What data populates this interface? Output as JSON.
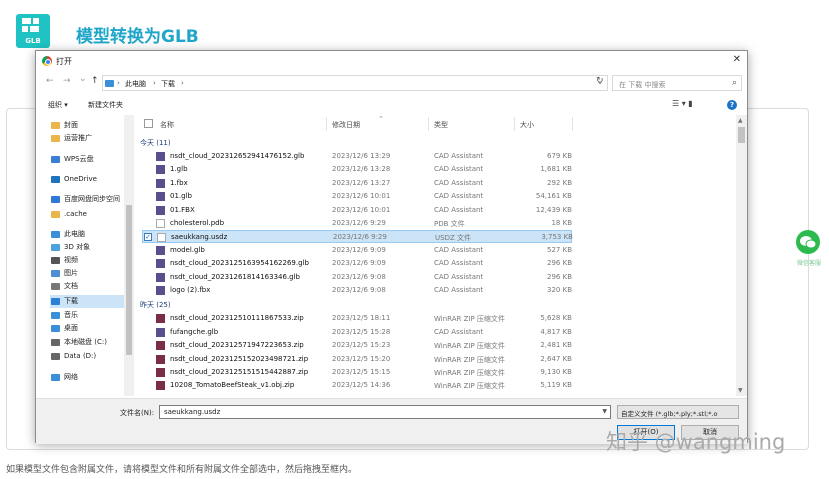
{
  "page": {
    "logo_text": "GLB",
    "title": "模型转换为GLB",
    "note": "如果模型文件包含附属文件，请将模型文件和所有附属文件全部选中，然后拖拽至框内。",
    "wechat_label": "微信客服",
    "watermark": "知乎 @wangming"
  },
  "dialog": {
    "title": "打开",
    "close": "✕",
    "nav": {
      "back": "←",
      "forward": "→",
      "recent": "⌄",
      "up": "↑"
    },
    "breadcrumb": [
      "此电脑",
      "下载"
    ],
    "breadcrumb_sep": "›",
    "refresh": "↻",
    "search_placeholder": "在 下载 中搜索",
    "toolbar": {
      "organize": "组织 ▾",
      "new_folder": "新建文件夹",
      "view": "☰ ▾  ▮",
      "help": "?"
    },
    "sidebar": [
      {
        "label": "封面",
        "icon": "folder-icon",
        "color": "#e8b64a"
      },
      {
        "label": "运营推广",
        "icon": "folder-icon",
        "color": "#e8b64a"
      },
      {
        "label": "WPS云盘",
        "icon": "cloud-icon",
        "color": "#3a7fd5"
      },
      {
        "label": "OneDrive",
        "icon": "cloud-icon",
        "color": "#1e73be"
      },
      {
        "label": "百度网盘同步空间",
        "icon": "baidu-icon",
        "color": "#2f7ad8"
      },
      {
        "label": ".cache",
        "icon": "folder-icon",
        "color": "#e8b64a"
      },
      {
        "label": "此电脑",
        "icon": "computer-icon",
        "color": "#3a8fd8"
      },
      {
        "label": "3D 对象",
        "icon": "cube-icon",
        "color": "#4aa3df"
      },
      {
        "label": "视频",
        "icon": "video-icon",
        "color": "#555"
      },
      {
        "label": "图片",
        "icon": "picture-icon",
        "color": "#4c8fd3"
      },
      {
        "label": "文档",
        "icon": "document-icon",
        "color": "#777"
      },
      {
        "label": "下载",
        "icon": "download-icon",
        "color": "#2b7fd4",
        "selected": true
      },
      {
        "label": "音乐",
        "icon": "music-icon",
        "color": "#3a8fd8"
      },
      {
        "label": "桌面",
        "icon": "desktop-icon",
        "color": "#3a8fd8"
      },
      {
        "label": "本地磁盘 (C:)",
        "icon": "drive-icon",
        "color": "#666"
      },
      {
        "label": "Data (D:)",
        "icon": "drive-icon",
        "color": "#666"
      },
      {
        "label": "网络",
        "icon": "network-icon",
        "color": "#3a8fd8"
      }
    ],
    "columns": {
      "name": "名称",
      "date": "修改日期",
      "type": "类型",
      "size": "大小"
    },
    "groups": [
      {
        "label": "今天 (11)",
        "files": [
          {
            "name": "nsdt_cloud_202312652941476152.glb",
            "date": "2023/12/6 13:29",
            "type": "CAD Assistant",
            "size": "679 KB",
            "icon": "cad-file-icon"
          },
          {
            "name": "1.glb",
            "date": "2023/12/6 13:28",
            "type": "CAD Assistant",
            "size": "1,681 KB",
            "icon": "cad-file-icon"
          },
          {
            "name": "1.fbx",
            "date": "2023/12/6 13:27",
            "type": "CAD Assistant",
            "size": "292 KB",
            "icon": "cad-file-icon"
          },
          {
            "name": "01.glb",
            "date": "2023/12/6 10:01",
            "type": "CAD Assistant",
            "size": "54,161 KB",
            "icon": "cad-file-icon"
          },
          {
            "name": "01.FBX",
            "date": "2023/12/6 10:01",
            "type": "CAD Assistant",
            "size": "12,439 KB",
            "icon": "cad-file-icon"
          },
          {
            "name": "cholesterol.pdb",
            "date": "2023/12/6 9:29",
            "type": "PDB 文件",
            "size": "18 KB",
            "icon": "blank-file-icon"
          },
          {
            "name": "saeukkang.usdz",
            "date": "2023/12/6 9:29",
            "type": "USDZ 文件",
            "size": "3,753 KB",
            "icon": "blank-file-icon",
            "selected": true
          },
          {
            "name": "model.glb",
            "date": "2023/12/6 9:09",
            "type": "CAD Assistant",
            "size": "527 KB",
            "icon": "cad-file-icon"
          },
          {
            "name": "nsdt_cloud_20231251639541​62269.glb",
            "date": "2023/12/6 9:09",
            "type": "CAD Assistant",
            "size": "296 KB",
            "icon": "cad-file-icon"
          },
          {
            "name": "nsdt_cloud_202312618141633​46.glb",
            "date": "2023/12/6 9:08",
            "type": "CAD Assistant",
            "size": "296 KB",
            "icon": "cad-file-icon"
          },
          {
            "name": "logo (2).fbx",
            "date": "2023/12/6 9:08",
            "type": "CAD Assistant",
            "size": "320 KB",
            "icon": "cad-file-icon"
          }
        ]
      },
      {
        "label": "昨天 (25)",
        "files": [
          {
            "name": "nsdt_cloud_2023125101118​67533.zip",
            "date": "2023/12/5 18:11",
            "type": "WinRAR ZIP 压缩文件",
            "size": "5,628 KB",
            "icon": "zip-file-icon"
          },
          {
            "name": "fufangche.glb",
            "date": "2023/12/5 15:28",
            "type": "CAD Assistant",
            "size": "4,817 KB",
            "icon": "cad-file-icon"
          },
          {
            "name": "nsdt_cloud_2023125719472​23653.zip",
            "date": "2023/12/5 15:23",
            "type": "WinRAR ZIP 压缩文件",
            "size": "2,481 KB",
            "icon": "zip-file-icon"
          },
          {
            "name": "nsdt_cloud_2023125152023​498721.zip",
            "date": "2023/12/5 15:20",
            "type": "WinRAR ZIP 压缩文件",
            "size": "2,647 KB",
            "icon": "zip-file-icon"
          },
          {
            "name": "nsdt_cloud_20231251515154​42887.zip",
            "date": "2023/12/5 15:15",
            "type": "WinRAR ZIP 压缩文件",
            "size": "9,130 KB",
            "icon": "zip-file-icon"
          },
          {
            "name": "10208_TomatoBeefSteak_v1.obj.zip",
            "date": "2023/12/5 14:36",
            "type": "WinRAR ZIP 压缩文件",
            "size": "5,119 KB",
            "icon": "zip-file-icon"
          }
        ]
      }
    ],
    "bottom": {
      "filename_label": "文件名(N):",
      "filename_value": "saeukkang.usdz",
      "filter_value": "自定义文件 (*.glb;*.ply;*.stl;*.o",
      "open_button": "打开(O)",
      "cancel_button": "取消"
    }
  }
}
